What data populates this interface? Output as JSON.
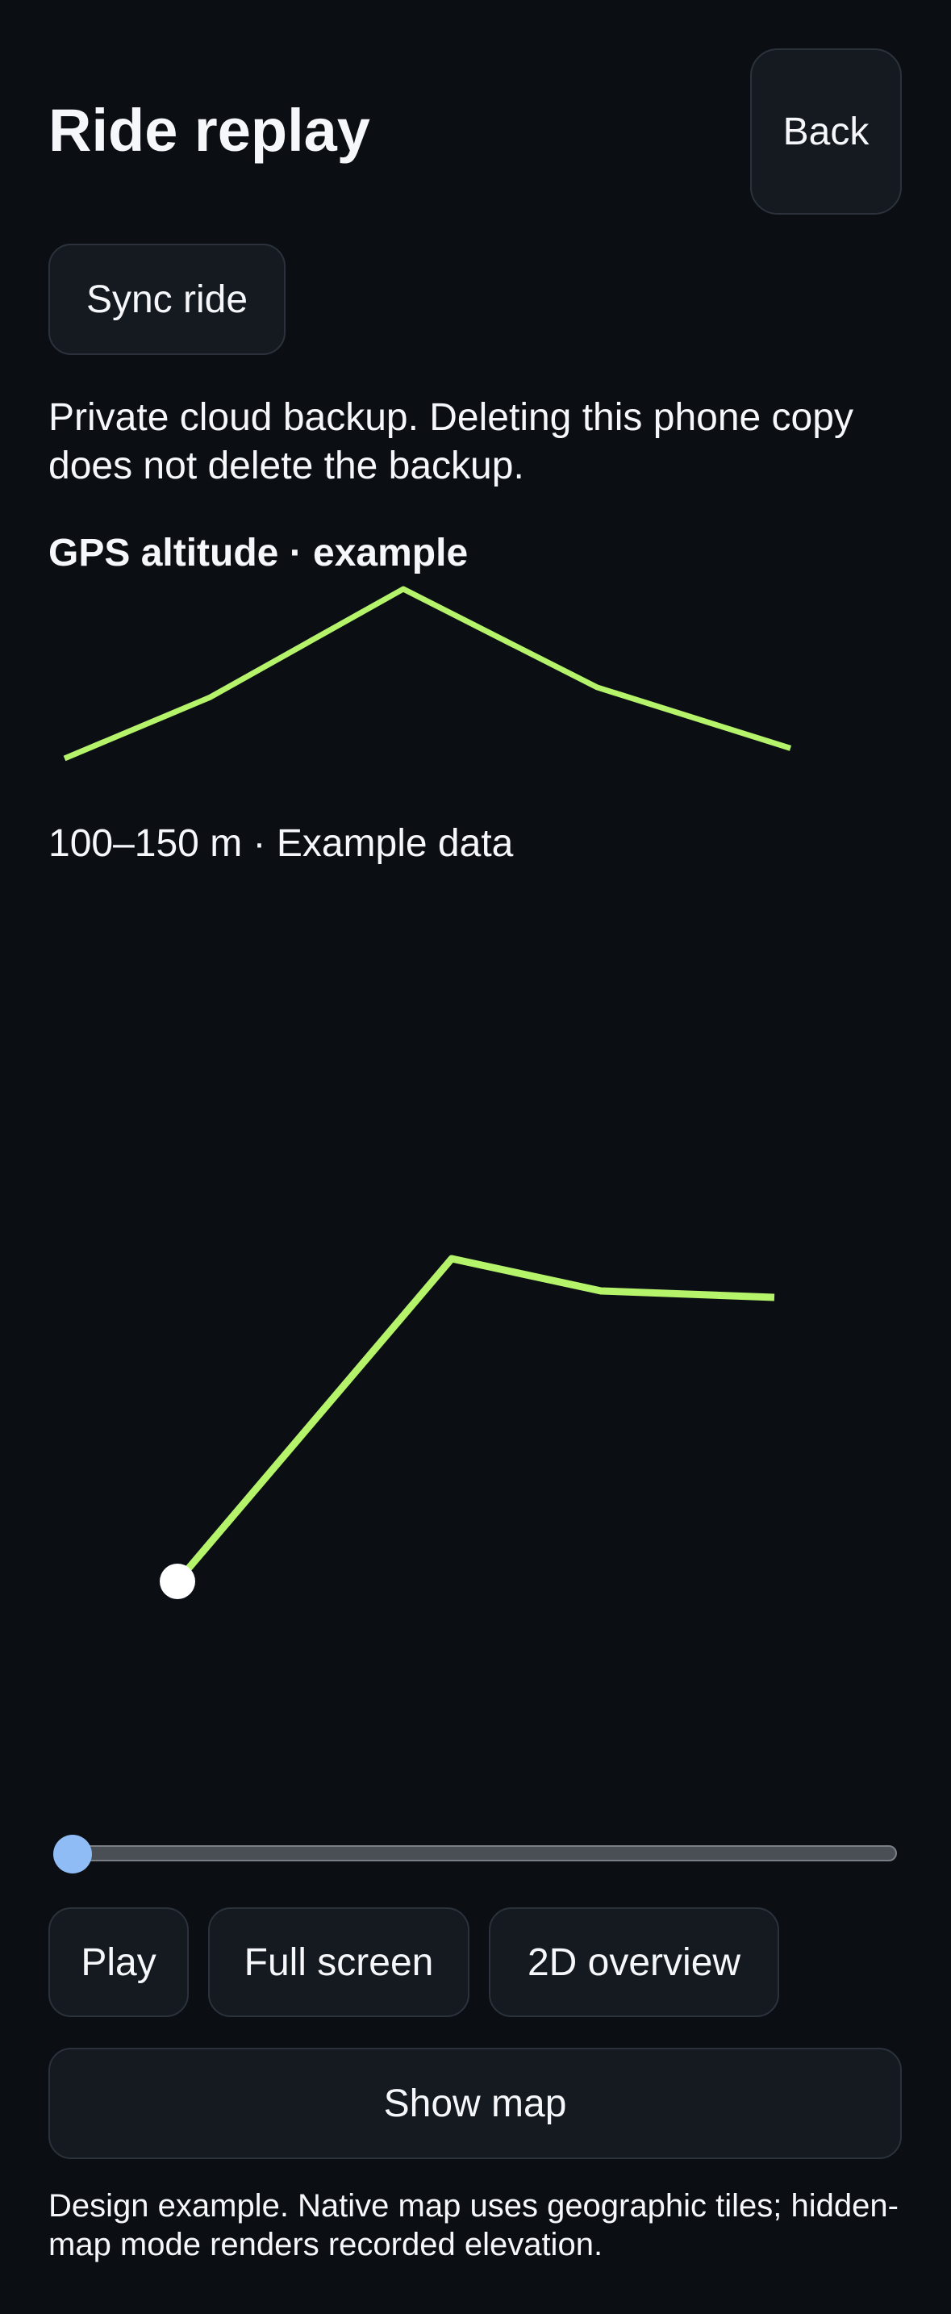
{
  "header": {
    "title": "Ride replay",
    "back_label": "Back"
  },
  "actions": {
    "sync_label": "Sync ride"
  },
  "notice": "Private cloud backup. Deleting this phone copy does not delete the backup.",
  "altitude": {
    "title": "GPS altitude · example",
    "range_text": "100–150 m · Example data",
    "line_color": "#b5f36b"
  },
  "chart_data": {
    "type": "line",
    "title": "GPS altitude · example",
    "series": [
      {
        "values": [
          100,
          118,
          150,
          121,
          103
        ]
      }
    ],
    "ylim": [
      100,
      150
    ],
    "grid": false
  },
  "replay": {
    "track_values": [
      [
        0.22,
        0.0
      ],
      [
        0.56,
        1.0
      ],
      [
        0.745,
        0.9
      ],
      [
        0.96,
        0.88
      ]
    ],
    "position_marker_color": "#ffffff"
  },
  "slider": {
    "progress": 0.0,
    "thumb_color": "#8fbcf5"
  },
  "controls": {
    "play_label": "Play",
    "fullscreen_label": "Full screen",
    "overview_label": "2D overview",
    "show_map_label": "Show map"
  },
  "footer": "Design example. Native map uses geographic tiles; hidden-map mode renders recorded elevation."
}
